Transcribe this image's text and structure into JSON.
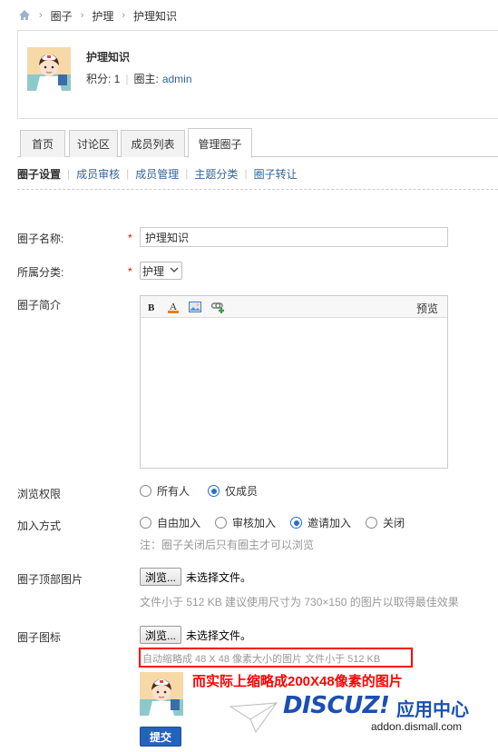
{
  "breadcrumb": {
    "items": [
      "圈子",
      "护理",
      "护理知识"
    ]
  },
  "group": {
    "name": "护理知识",
    "points_label": "积分: 1",
    "owner_label": "圈主:",
    "owner_name": "admin"
  },
  "tabs": [
    {
      "label": "首页"
    },
    {
      "label": "讨论区"
    },
    {
      "label": "成员列表"
    },
    {
      "label": "管理圈子",
      "active": true
    }
  ],
  "subnav": [
    "圈子设置",
    "成员审核",
    "成员管理",
    "主题分类",
    "圈子转让"
  ],
  "form": {
    "name_label": "圈子名称:",
    "name_value": "护理知识",
    "category_label": "所属分类:",
    "category_value": "护理",
    "intro_label": "圈子简介",
    "preview_label": "预览",
    "view_label": "浏览权限",
    "view_options": [
      "所有人",
      "仅成员"
    ],
    "join_label": "加入方式",
    "join_options": [
      "自由加入",
      "审核加入",
      "邀请加入",
      "关闭"
    ],
    "join_note": "注：圈子关闭后只有圈主才可以浏览",
    "banner_label": "圈子顶部图片",
    "browse_label": "浏览...",
    "no_file_label": "未选择文件。",
    "banner_hint": "文件小于 512 KB   建议使用尺寸为 730×150 的图片以取得最佳效果",
    "icon_label": "圈子图标",
    "icon_hint": "自动缩略成 48 X 48 像素大小的图片   文件小于 512 KB",
    "submit_label": "提交"
  },
  "annotation": {
    "text": "而实际上缩略成200X48像素的图片"
  },
  "watermark": {
    "brand": "DISCUZ!",
    "cn": "应用中心",
    "url": "addon.dismall.com"
  },
  "colors": {
    "link": "#336699",
    "required": "#ff0000",
    "submit": "#2263be",
    "annotation": "#ff0000",
    "brand": "#1a4fb3"
  }
}
